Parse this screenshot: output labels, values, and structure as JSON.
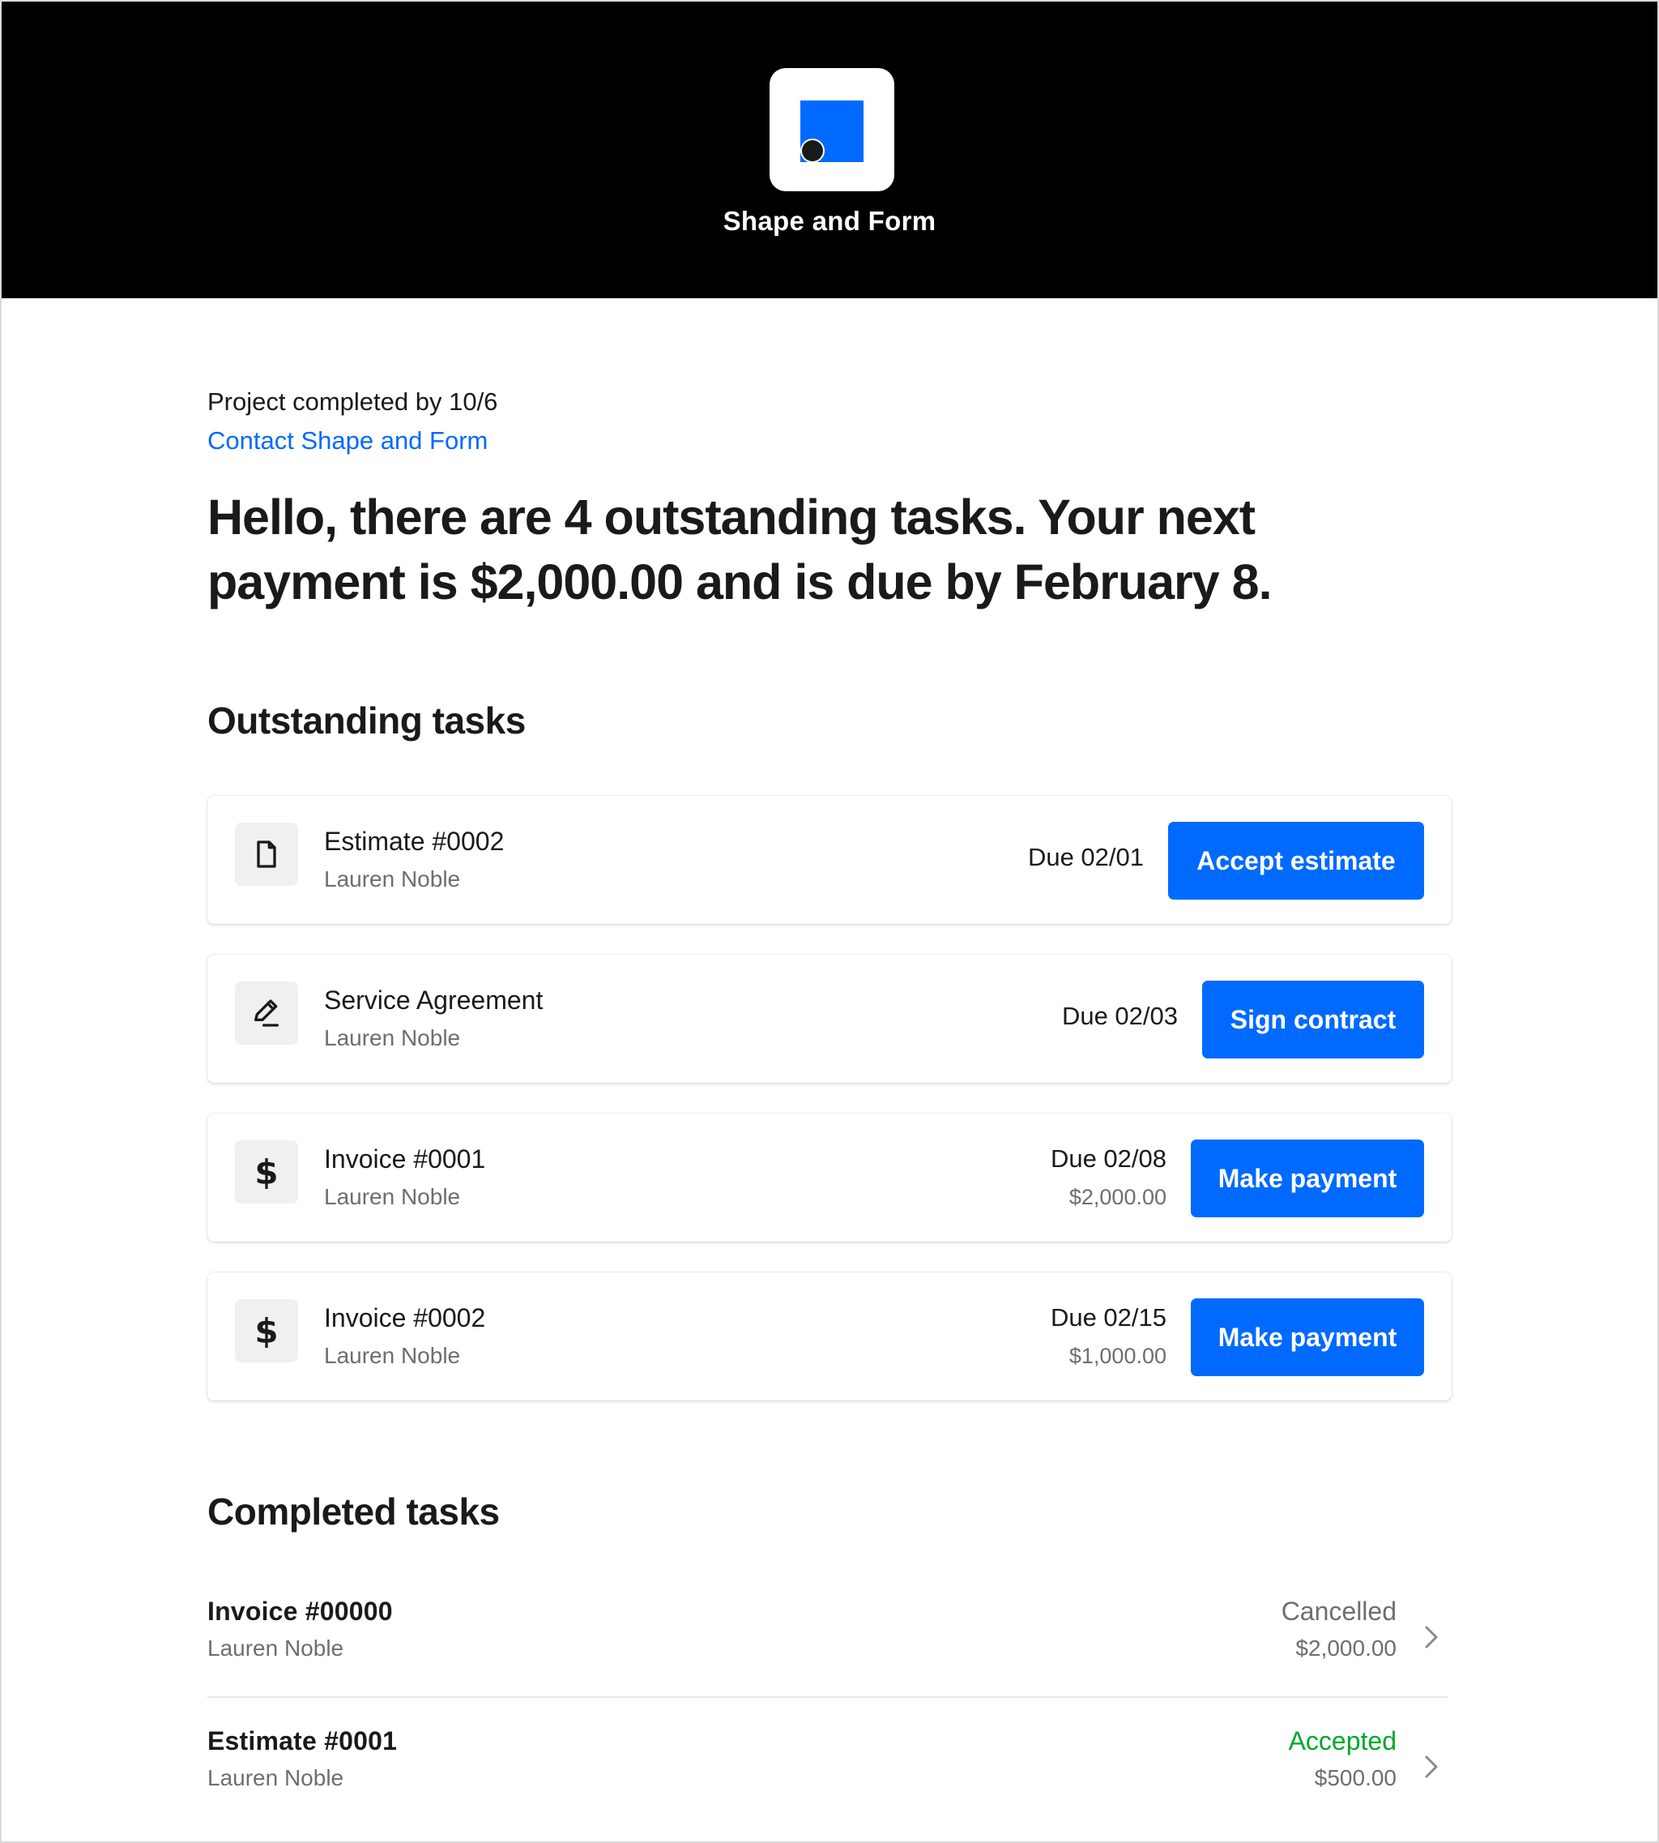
{
  "brand": {
    "name": "Shape and Form",
    "logo_square_color": "#006aff",
    "logo_dot_color": "#1a1a1a"
  },
  "intro": {
    "project_status": "Project completed by 10/6",
    "contact_link": "Contact Shape and Form",
    "greeting": "Hello, there are 4 outstanding tasks. Your next payment is $2,000.00 and is due by February 8."
  },
  "outstanding": {
    "title": "Outstanding tasks",
    "tasks": [
      {
        "icon": "document-icon",
        "title": "Estimate #0002",
        "subtitle": "Lauren Noble",
        "due": "Due 02/01",
        "amount": "",
        "action": "Accept estimate"
      },
      {
        "icon": "pen-icon",
        "title": "Service Agreement",
        "subtitle": "Lauren Noble",
        "due": "Due 02/03",
        "amount": "",
        "action": "Sign contract"
      },
      {
        "icon": "dollar-icon",
        "title": "Invoice #0001",
        "subtitle": "Lauren Noble",
        "due": "Due 02/08",
        "amount": "$2,000.00",
        "action": "Make payment"
      },
      {
        "icon": "dollar-icon",
        "title": "Invoice #0002",
        "subtitle": "Lauren Noble",
        "due": "Due 02/15",
        "amount": "$1,000.00",
        "action": "Make payment"
      }
    ]
  },
  "completed": {
    "title": "Completed tasks",
    "tasks": [
      {
        "title": "Invoice #00000",
        "subtitle": "Lauren Noble",
        "status": "Cancelled",
        "status_color": "#6e6e6e",
        "amount": "$2,000.00"
      },
      {
        "title": "Estimate #0001",
        "subtitle": "Lauren Noble",
        "status": "Accepted",
        "status_color": "#00a82d",
        "amount": "$500.00"
      }
    ]
  },
  "colors": {
    "accent": "#006aff",
    "header_bg": "#000000",
    "success": "#00a82d"
  }
}
